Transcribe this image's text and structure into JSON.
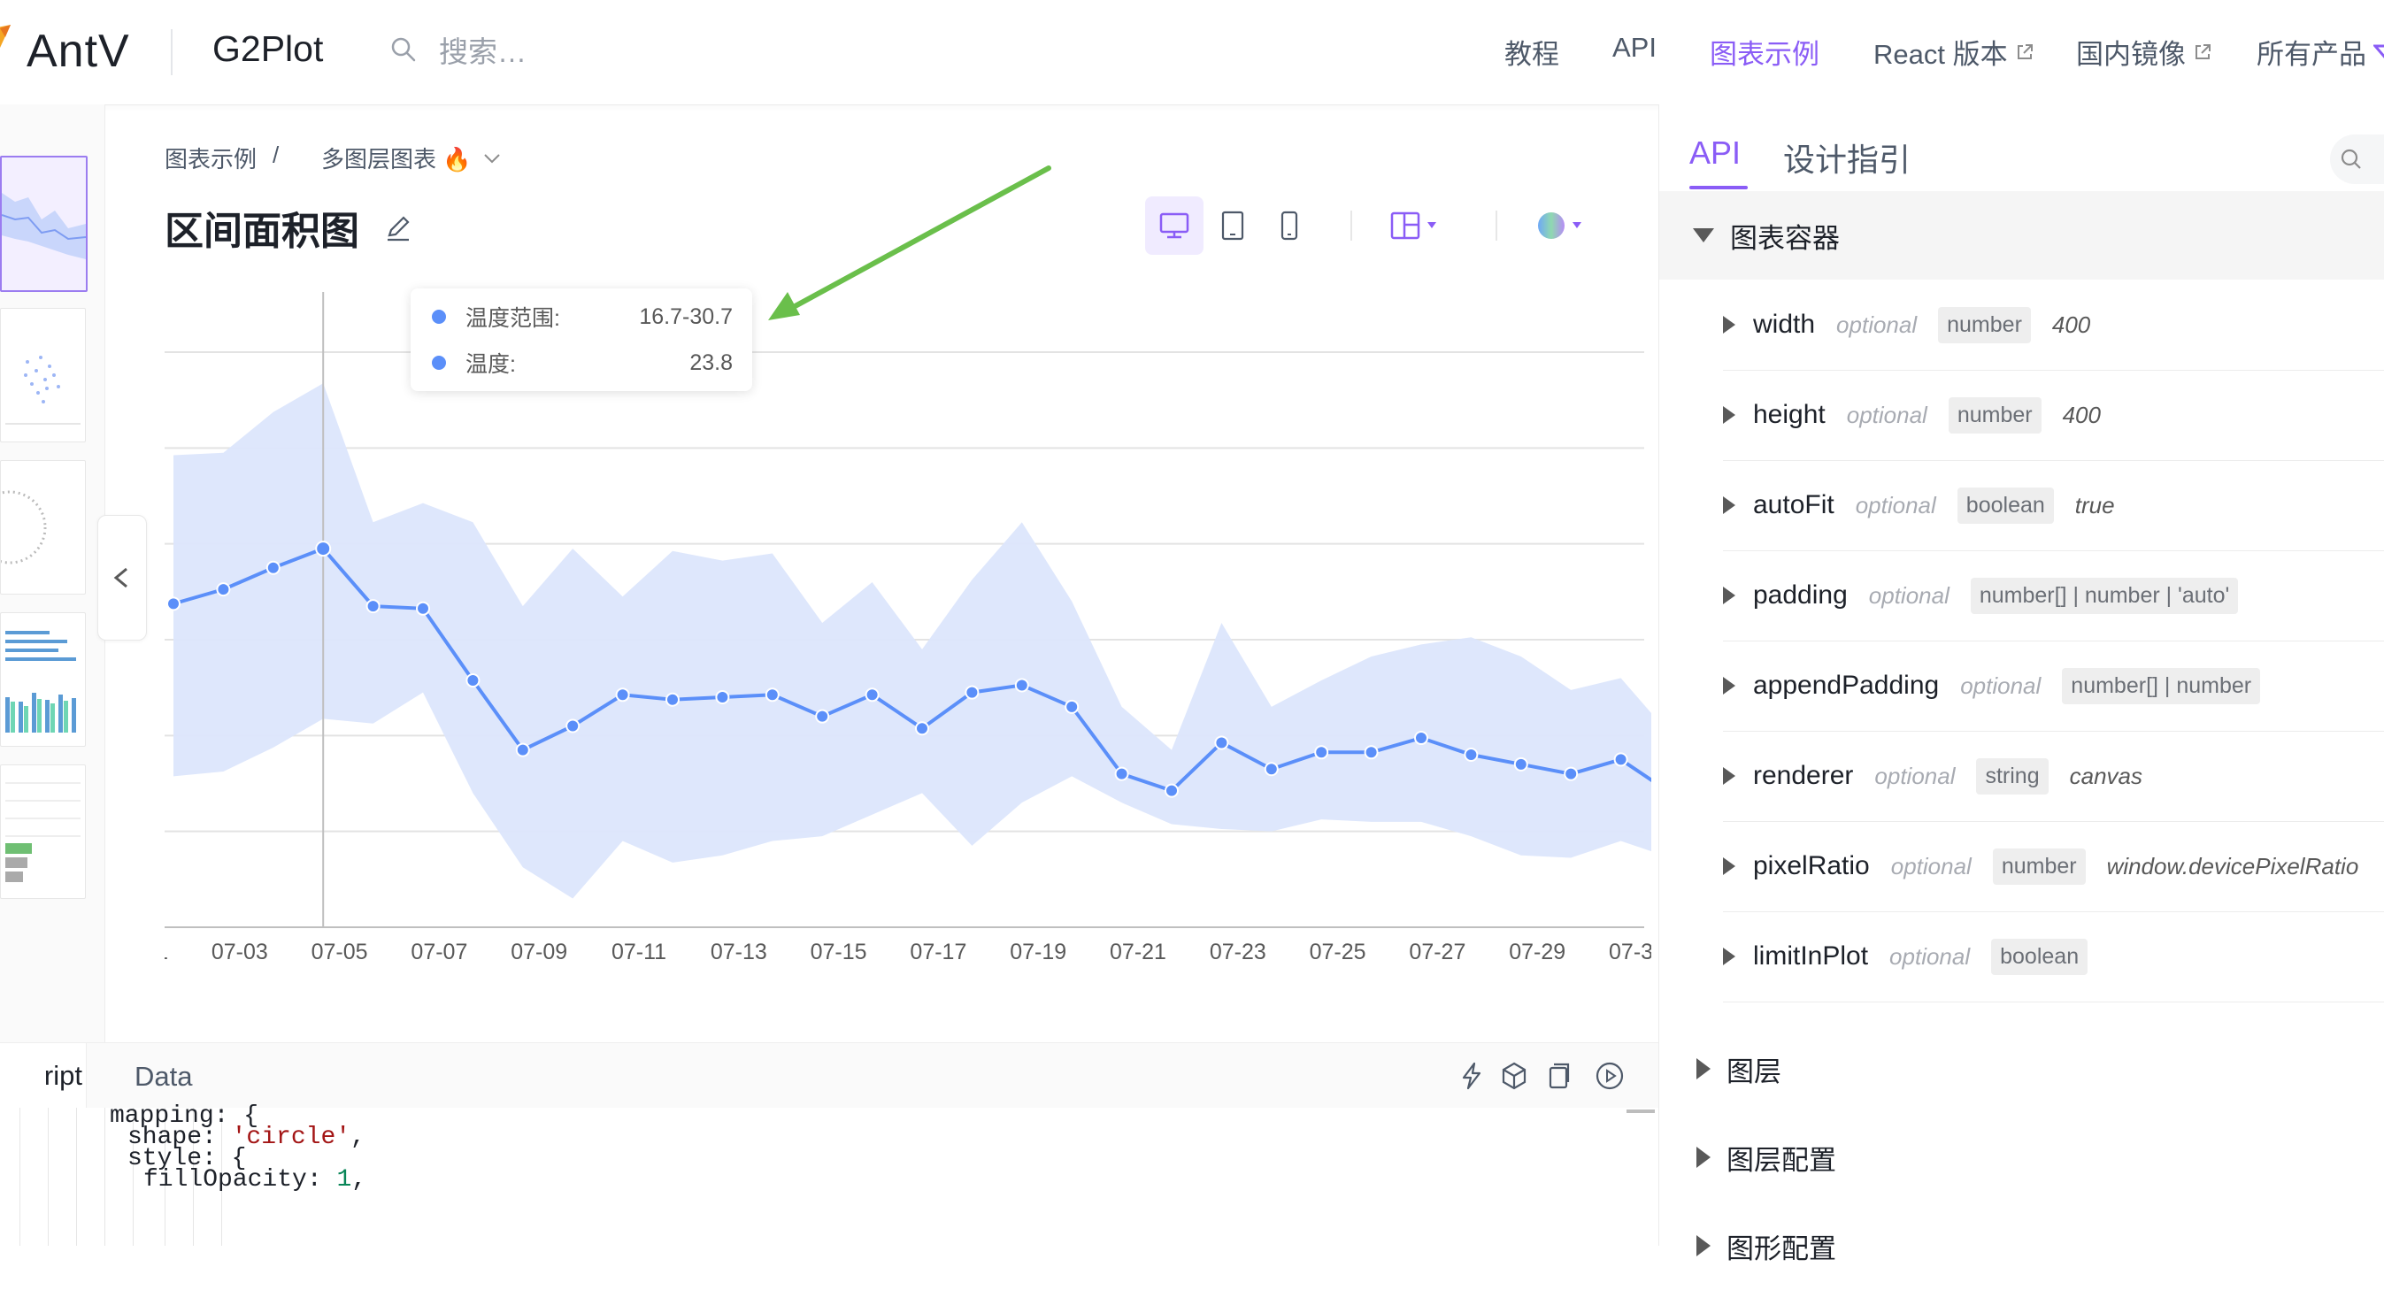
{
  "nav": {
    "brand": "AntV",
    "product": "G2Plot",
    "search_placeholder": "搜索…",
    "items": [
      {
        "label": "教程",
        "active": false,
        "external": false
      },
      {
        "label": "API",
        "active": false,
        "external": false
      },
      {
        "label": "图表示例",
        "active": true,
        "external": false
      },
      {
        "label": "React 版本",
        "active": false,
        "external": true
      },
      {
        "label": "国内镜像",
        "active": false,
        "external": true
      },
      {
        "label": "所有产品",
        "active": false,
        "external": false
      }
    ]
  },
  "breadcrumb": {
    "root": "图表示例",
    "separator": "/",
    "current": "多图层图表 🔥"
  },
  "page_title": "区间面积图",
  "tooltip": {
    "rows": [
      {
        "label": "温度范围:",
        "value": "16.7-30.7"
      },
      {
        "label": "温度:",
        "value": "23.8"
      }
    ]
  },
  "colors": {
    "accent": "#8a5cf6",
    "series": "#5b8ff9",
    "area": "#dce6fc",
    "arrow": "#6abf4b"
  },
  "chart_data": {
    "type": "area",
    "x": [
      "07-01",
      "07-02",
      "07-03",
      "07-04",
      "07-05",
      "07-06",
      "07-07",
      "07-08",
      "07-09",
      "07-10",
      "07-11",
      "07-12",
      "07-13",
      "07-14",
      "07-15",
      "07-16",
      "07-17",
      "07-18",
      "07-19",
      "07-20",
      "07-21",
      "07-22",
      "07-23",
      "07-24",
      "07-25",
      "07-26",
      "07-27",
      "07-28",
      "07-29",
      "07-30",
      "07-31"
    ],
    "x_tick_labels": [
      "07-01",
      "07-03",
      "07-05",
      "07-07",
      "07-09",
      "07-11",
      "07-13",
      "07-15",
      "07-17",
      "07-19",
      "07-21",
      "07-23",
      "07-25",
      "07-27",
      "07-29",
      "07-31"
    ],
    "y_ticks": [
      8,
      12,
      16,
      20,
      24,
      28,
      32
    ],
    "ylim": [
      8,
      32
    ],
    "grid": true,
    "series": [
      {
        "values": [
          21.5,
          22.1,
          23.0,
          23.8,
          21.4,
          21.3,
          18.3,
          15.4,
          16.4,
          17.7,
          17.5,
          17.6,
          17.7,
          16.8,
          17.7,
          16.3,
          17.8,
          18.1,
          17.2,
          14.4,
          13.7,
          15.7,
          14.6,
          15.3,
          15.3,
          15.9,
          15.2,
          14.8,
          14.4,
          15.0,
          13.6
        ]
      },
      {
        "lower": [
          14.3,
          14.5,
          15.5,
          16.7,
          16.5,
          17.8,
          13.6,
          10.5,
          9.2,
          11.6,
          10.7,
          11.0,
          11.6,
          11.8,
          12.7,
          13.6,
          11.4,
          13.2,
          14.3,
          13.2,
          12.3,
          12.1,
          12.0,
          12.5,
          12.4,
          12.4,
          11.8,
          11.0,
          10.9,
          11.6,
          10.9
        ],
        "upper": [
          27.7,
          27.8,
          29.5,
          30.7,
          24.9,
          25.7,
          24.9,
          21.4,
          23.8,
          21.8,
          23.7,
          23.3,
          23.6,
          20.7,
          22.4,
          19.6,
          22.5,
          24.9,
          21.6,
          17.2,
          15.4,
          20.7,
          17.2,
          18.3,
          19.3,
          19.8,
          20.1,
          19.3,
          17.9,
          18.4,
          16.0
        ]
      }
    ]
  },
  "editor": {
    "tab_script": "ript",
    "tab_data": "Data",
    "code_lines": [
      [
        {
          "t": "mapping: {",
          "k": "plain"
        }
      ],
      [
        {
          "t": "shape: ",
          "k": "plain"
        },
        {
          "t": "'circle'",
          "k": "str"
        },
        {
          "t": ",",
          "k": "plain"
        }
      ],
      [
        {
          "t": "style: {",
          "k": "plain"
        }
      ],
      [
        {
          "t": "fillOpacity: ",
          "k": "plain"
        },
        {
          "t": "1",
          "k": "num"
        },
        {
          "t": ",",
          "k": "plain"
        }
      ]
    ]
  },
  "right_panel": {
    "tabs": [
      "API",
      "设计指引"
    ],
    "sections": [
      "图表容器",
      "图层",
      "图层配置",
      "图形配置"
    ],
    "props": [
      {
        "name": "width",
        "optional": "optional",
        "type": "number",
        "default": "400"
      },
      {
        "name": "height",
        "optional": "optional",
        "type": "number",
        "default": "400"
      },
      {
        "name": "autoFit",
        "optional": "optional",
        "type": "boolean",
        "default": "true"
      },
      {
        "name": "padding",
        "optional": "optional",
        "type": "number[] | number | 'auto'",
        "default": ""
      },
      {
        "name": "appendPadding",
        "optional": "optional",
        "type": "number[] | number",
        "default": ""
      },
      {
        "name": "renderer",
        "optional": "optional",
        "type": "string",
        "default": "canvas"
      },
      {
        "name": "pixelRatio",
        "optional": "optional",
        "type": "number",
        "default": "window.devicePixelRatio"
      },
      {
        "name": "limitInPlot",
        "optional": "optional",
        "type": "boolean",
        "default": ""
      }
    ]
  }
}
